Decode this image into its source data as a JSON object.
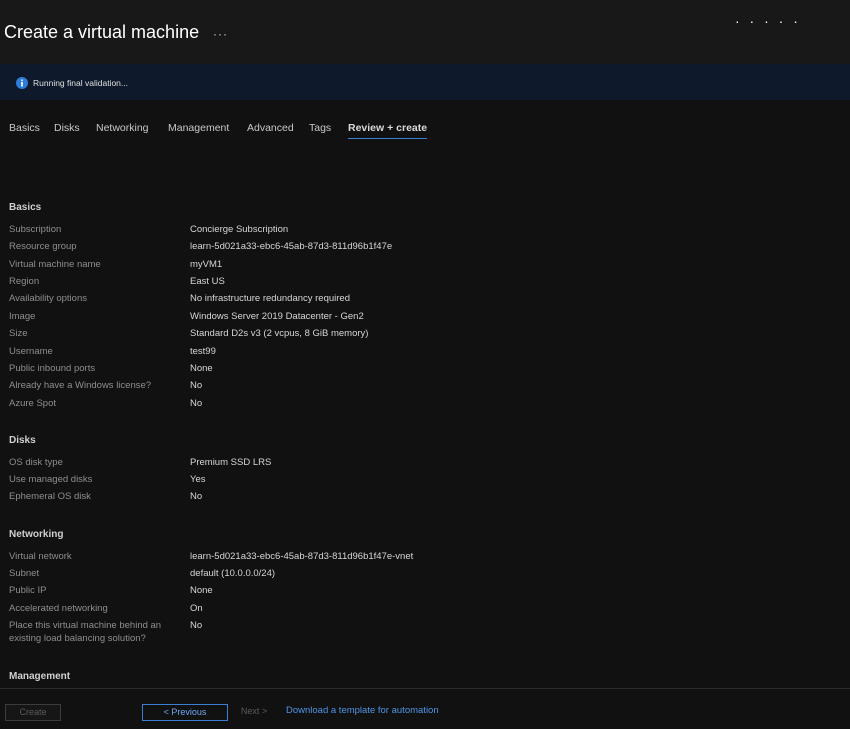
{
  "header": {
    "title": "Create a virtual machine",
    "more_label": "···",
    "window_dots": "· · · · ·"
  },
  "banner": {
    "text": "Running final validation...",
    "icon": "info-icon",
    "accent": "#2f7bd8"
  },
  "tabs": [
    {
      "label": "Basics"
    },
    {
      "label": "Disks"
    },
    {
      "label": "Networking"
    },
    {
      "label": "Management"
    },
    {
      "label": "Advanced"
    },
    {
      "label": "Tags"
    },
    {
      "label": "Review + create",
      "active": true
    }
  ],
  "sections": {
    "basics": {
      "title": "Basics",
      "rows": [
        {
          "label": "Subscription",
          "value": "Concierge Subscription"
        },
        {
          "label": "Resource group",
          "value": "learn-5d021a33-ebc6-45ab-87d3-811d96b1f47e"
        },
        {
          "label": "Virtual machine name",
          "value": "myVM1"
        },
        {
          "label": "Region",
          "value": "East US"
        },
        {
          "label": "Availability options",
          "value": "No infrastructure redundancy required"
        },
        {
          "label": "Image",
          "value": "Windows Server 2019 Datacenter - Gen2"
        },
        {
          "label": "Size",
          "value": "Standard D2s v3 (2 vcpus, 8 GiB memory)"
        },
        {
          "label": "Username",
          "value": "test99"
        },
        {
          "label": "Public inbound ports",
          "value": "None"
        },
        {
          "label": "Already have a Windows license?",
          "value": "No"
        },
        {
          "label": "Azure Spot",
          "value": "No"
        }
      ]
    },
    "disks": {
      "title": "Disks",
      "rows": [
        {
          "label": "OS disk type",
          "value": "Premium SSD LRS"
        },
        {
          "label": "Use managed disks",
          "value": "Yes"
        },
        {
          "label": "Ephemeral OS disk",
          "value": "No"
        }
      ]
    },
    "networking": {
      "title": "Networking",
      "rows": [
        {
          "label": "Virtual network",
          "value": "learn-5d021a33-ebc6-45ab-87d3-811d96b1f47e-vnet"
        },
        {
          "label": "Subnet",
          "value": "default (10.0.0.0/24)"
        },
        {
          "label": "Public IP",
          "value": "None"
        },
        {
          "label": "Accelerated networking",
          "value": "On"
        },
        {
          "label": "Place this virtual machine behind an",
          "label2": "existing load balancing solution?",
          "value": "No"
        }
      ]
    },
    "management": {
      "title": "Management"
    }
  },
  "footer": {
    "create_label": "Create",
    "previous_label": "< Previous",
    "next_label": "Next >",
    "download_label": "Download a template for automation"
  }
}
